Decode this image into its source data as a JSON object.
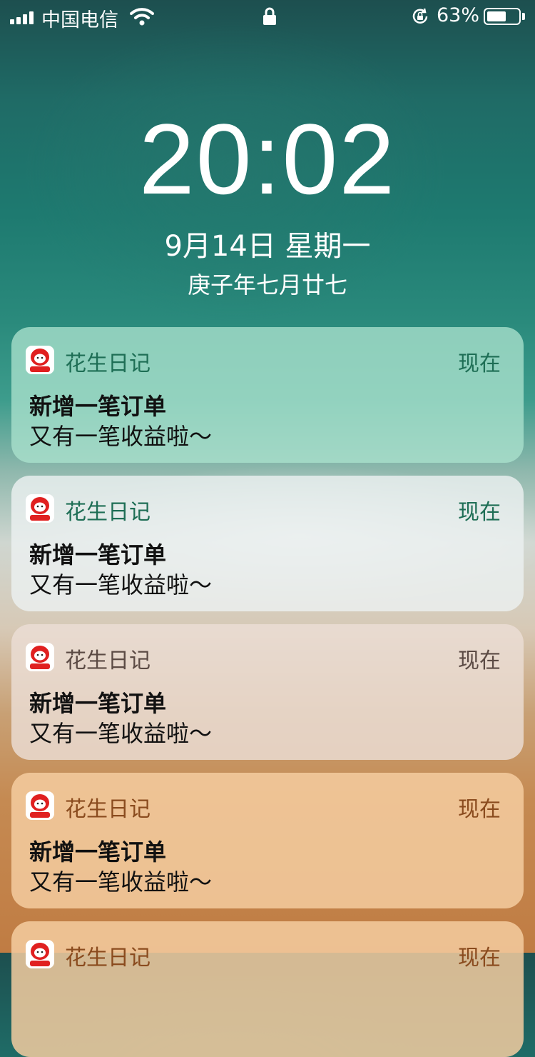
{
  "status_bar": {
    "carrier": "中国电信",
    "battery_percent": "63%",
    "battery_level": 0.63
  },
  "lock_screen": {
    "time": "20:02",
    "date": "9月14日 星期一",
    "lunar_date": "庚子年七月廿七"
  },
  "notifications": [
    {
      "app": "花生日记",
      "time": "现在",
      "title": "新增一笔订单",
      "body": "又有一笔收益啦～"
    },
    {
      "app": "花生日记",
      "time": "现在",
      "title": "新增一笔订单",
      "body": "又有一笔收益啦～"
    },
    {
      "app": "花生日记",
      "time": "现在",
      "title": "新增一笔订单",
      "body": "又有一笔收益啦～"
    },
    {
      "app": "花生日记",
      "time": "现在",
      "title": "新增一笔订单",
      "body": "又有一笔收益啦～"
    },
    {
      "app": "花生日记",
      "time": "现在",
      "title": "",
      "body": ""
    }
  ],
  "colors": {
    "accent_green": "#1e6e55",
    "accent_brown": "#8a4b1e",
    "icon_red": "#e02020"
  }
}
